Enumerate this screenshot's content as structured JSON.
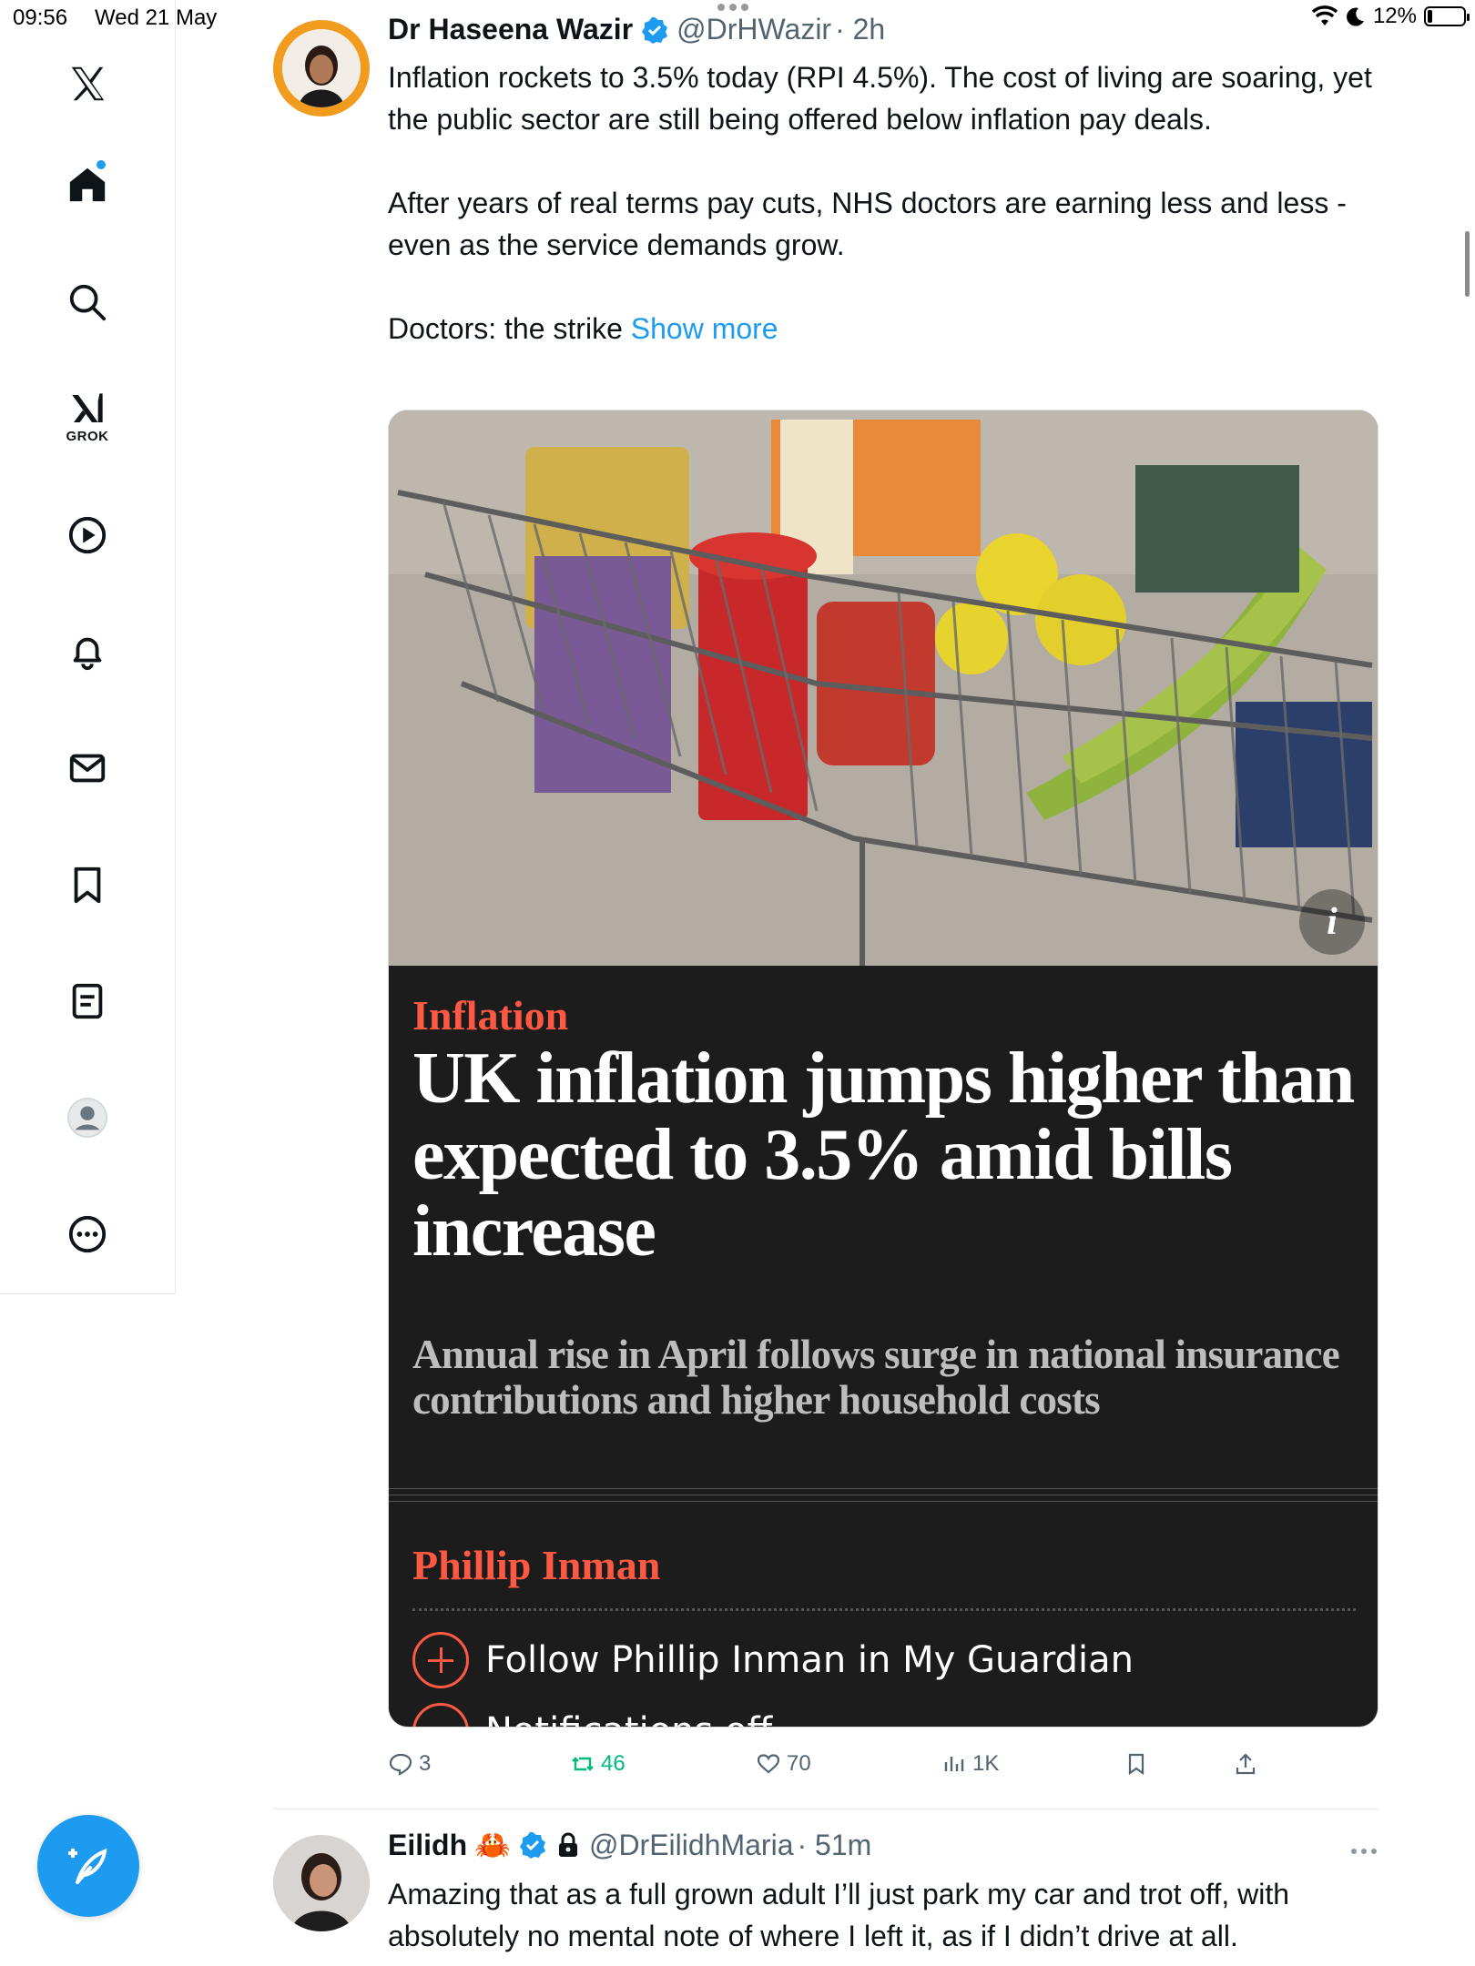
{
  "status_bar": {
    "time": "09:56",
    "date": "Wed 21 May",
    "battery": "12%",
    "battery_level": 0.12
  },
  "sidebar": {
    "items": [
      {
        "name": "x-logo",
        "label": ""
      },
      {
        "name": "home",
        "label": ""
      },
      {
        "name": "search",
        "label": ""
      },
      {
        "name": "grok",
        "label": "GROK"
      },
      {
        "name": "video",
        "label": ""
      },
      {
        "name": "notifications",
        "label": ""
      },
      {
        "name": "messages",
        "label": ""
      },
      {
        "name": "bookmarks",
        "label": ""
      },
      {
        "name": "lists",
        "label": ""
      },
      {
        "name": "profile",
        "label": ""
      },
      {
        "name": "more",
        "label": ""
      }
    ]
  },
  "tweet": {
    "author": "Dr Haseena Wazir",
    "handle": "@DrHWazir",
    "time": "· 2h",
    "paragraphs": [
      "Inflation rockets to 3.5% today (RPI 4.5%). The cost of living are soaring, yet the public sector are still being offered below inflation pay deals.",
      "After years of real terms pay cuts, NHS doctors are earning less and less - even as the service demands grow."
    ],
    "truncated_text": "Doctors: the strike ",
    "show_more": "Show more",
    "card": {
      "kicker": "Inflation",
      "headline": "UK inflation jumps higher than expected to 3.5% amid bills increase",
      "standfirst": "Annual rise in April follows surge in national insurance contributions and higher household costs",
      "byline": "Phillip Inman",
      "follow": "Follow Phillip Inman in My Guardian",
      "notifications": "Notifications off",
      "info_icon": "i"
    },
    "actions": {
      "replies": "3",
      "retweets": "46",
      "likes": "70",
      "views": "1K"
    }
  },
  "tweet2": {
    "author": "Eilidh",
    "emoji": "🦀",
    "handle": "@DrEilidhMaria",
    "time": "· 51m",
    "text": "Amazing that as a full grown adult I’ll just park my car and trot off, with absolutely no mental note of where I left it, as if I didn’t drive at all."
  },
  "colors": {
    "accent": "#1d9bf0",
    "guardian_red": "#ff5943",
    "retweet_green": "#00ba7c",
    "muted": "#536471"
  }
}
